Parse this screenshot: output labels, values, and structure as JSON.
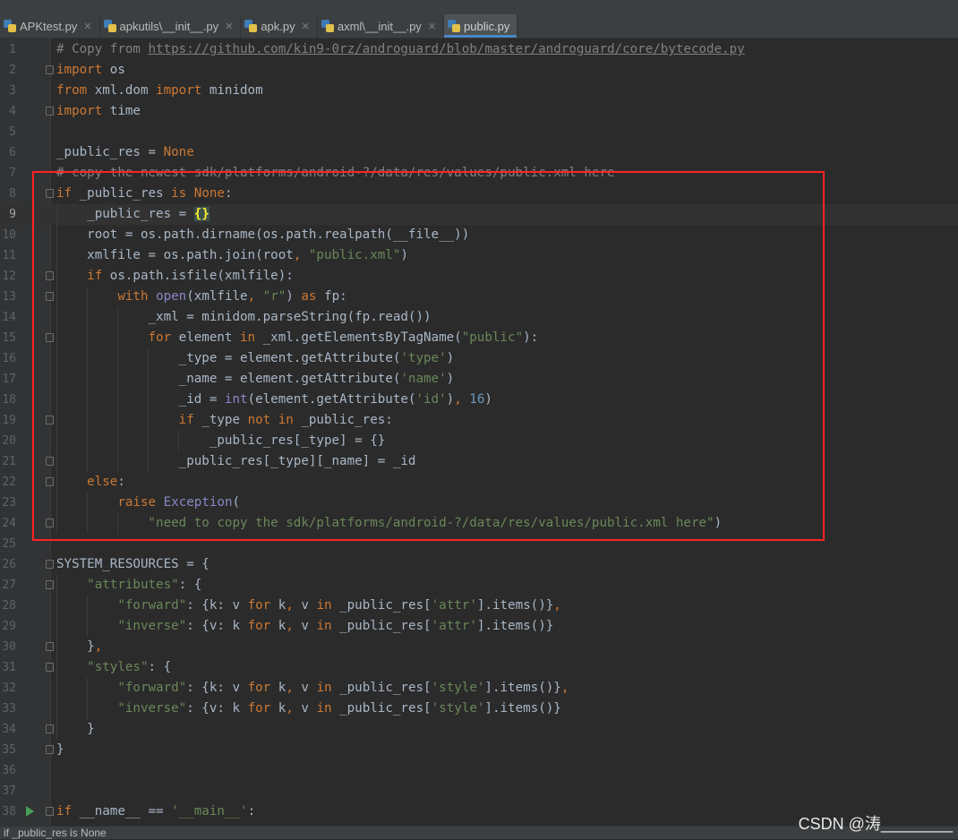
{
  "tabs": [
    {
      "label": "APKtest.py",
      "active": false
    },
    {
      "label": "apkutils\\__init__.py",
      "active": false
    },
    {
      "label": "apk.py",
      "active": false
    },
    {
      "label": "axml\\__init__.py",
      "active": false
    },
    {
      "label": "public.py",
      "active": true
    }
  ],
  "editor": {
    "current_line": 9,
    "lines": [
      {
        "n": "1",
        "parts": [
          [
            "c",
            "# Copy from "
          ],
          [
            "cu",
            "https://github.com/kin9-0rz/androguard/blob/master/androguard/core/bytecode.py"
          ]
        ]
      },
      {
        "n": "2",
        "fold": true,
        "parts": [
          [
            "k",
            "import"
          ],
          [
            "t",
            " os"
          ]
        ]
      },
      {
        "n": "3",
        "parts": [
          [
            "k",
            "from"
          ],
          [
            "t",
            " xml.dom "
          ],
          [
            "k",
            "import"
          ],
          [
            "t",
            " minidom"
          ]
        ]
      },
      {
        "n": "4",
        "fold": true,
        "parts": [
          [
            "k",
            "import"
          ],
          [
            "t",
            " time"
          ]
        ]
      },
      {
        "n": "5",
        "parts": []
      },
      {
        "n": "6",
        "parts": [
          [
            "t",
            "_public_res = "
          ],
          [
            "k",
            "None"
          ]
        ]
      },
      {
        "n": "7",
        "parts": [
          [
            "c",
            "# copy the newest sdk/platforms/android-?/data/res/values/public.xml here"
          ]
        ]
      },
      {
        "n": "8",
        "fold": true,
        "parts": [
          [
            "k",
            "if"
          ],
          [
            "t",
            " _public_res "
          ],
          [
            "k",
            "is"
          ],
          [
            "t",
            " "
          ],
          [
            "k",
            "None"
          ],
          [
            "t",
            ":"
          ]
        ]
      },
      {
        "n": "9",
        "parts": [
          [
            "t",
            "    _public_res = "
          ],
          [
            "br",
            "{}"
          ]
        ]
      },
      {
        "n": "10",
        "parts": [
          [
            "t",
            "    root = os.path.dirname(os.path.realpath(__file__))"
          ]
        ]
      },
      {
        "n": "11",
        "parts": [
          [
            "t",
            "    xmlfile = os.path.join(root"
          ],
          [
            "k",
            ", "
          ],
          [
            "s",
            "\"public.xml\""
          ],
          [
            "t",
            ")"
          ]
        ]
      },
      {
        "n": "12",
        "fold": true,
        "parts": [
          [
            "t",
            "    "
          ],
          [
            "k",
            "if"
          ],
          [
            "t",
            " os.path.isfile(xmlfile):"
          ]
        ]
      },
      {
        "n": "13",
        "fold": true,
        "parts": [
          [
            "t",
            "        "
          ],
          [
            "k",
            "with"
          ],
          [
            "t",
            " "
          ],
          [
            "b",
            "open"
          ],
          [
            "t",
            "(xmlfile"
          ],
          [
            "k",
            ", "
          ],
          [
            "s",
            "\"r\""
          ],
          [
            "t",
            ") "
          ],
          [
            "k",
            "as"
          ],
          [
            "t",
            " fp:"
          ]
        ]
      },
      {
        "n": "14",
        "parts": [
          [
            "t",
            "            _xml = minidom.parseString(fp.read())"
          ]
        ]
      },
      {
        "n": "15",
        "fold": true,
        "parts": [
          [
            "t",
            "            "
          ],
          [
            "k",
            "for"
          ],
          [
            "t",
            " element "
          ],
          [
            "k",
            "in"
          ],
          [
            "t",
            " _xml.getElementsByTagName("
          ],
          [
            "s",
            "\"public\""
          ],
          [
            "t",
            "):"
          ]
        ]
      },
      {
        "n": "16",
        "parts": [
          [
            "t",
            "                _type = element.getAttribute("
          ],
          [
            "s",
            "'type'"
          ],
          [
            "t",
            ")"
          ]
        ]
      },
      {
        "n": "17",
        "parts": [
          [
            "t",
            "                _name = element.getAttribute("
          ],
          [
            "s",
            "'name'"
          ],
          [
            "t",
            ")"
          ]
        ]
      },
      {
        "n": "18",
        "parts": [
          [
            "t",
            "                _id = "
          ],
          [
            "b",
            "int"
          ],
          [
            "t",
            "(element.getAttribute("
          ],
          [
            "s",
            "'id'"
          ],
          [
            "t",
            ")"
          ],
          [
            "k",
            ", "
          ],
          [
            "n",
            "16"
          ],
          [
            "t",
            ")"
          ]
        ]
      },
      {
        "n": "19",
        "fold": true,
        "parts": [
          [
            "t",
            "                "
          ],
          [
            "k",
            "if"
          ],
          [
            "t",
            " _type "
          ],
          [
            "k",
            "not in"
          ],
          [
            "t",
            " _public_res:"
          ]
        ]
      },
      {
        "n": "20",
        "parts": [
          [
            "t",
            "                    _public_res[_type] = {}"
          ]
        ]
      },
      {
        "n": "21",
        "fold": true,
        "parts": [
          [
            "t",
            "                _public_res[_type][_name] = _id"
          ]
        ]
      },
      {
        "n": "22",
        "fold": true,
        "parts": [
          [
            "t",
            "    "
          ],
          [
            "k",
            "else"
          ],
          [
            "t",
            ":"
          ]
        ]
      },
      {
        "n": "23",
        "parts": [
          [
            "t",
            "        "
          ],
          [
            "k",
            "raise"
          ],
          [
            "t",
            " "
          ],
          [
            "b",
            "Exception"
          ],
          [
            "t",
            "("
          ]
        ]
      },
      {
        "n": "24",
        "fold": true,
        "parts": [
          [
            "t",
            "            "
          ],
          [
            "s",
            "\"need to copy the sdk/platforms/android-?/data/res/values/public.xml here\""
          ],
          [
            "t",
            ")"
          ]
        ]
      },
      {
        "n": "25",
        "parts": []
      },
      {
        "n": "26",
        "fold": true,
        "parts": [
          [
            "t",
            "SYSTEM_RESOURCES = {"
          ]
        ]
      },
      {
        "n": "27",
        "fold": true,
        "parts": [
          [
            "t",
            "    "
          ],
          [
            "s",
            "\"attributes\""
          ],
          [
            "t",
            ": {"
          ]
        ]
      },
      {
        "n": "28",
        "parts": [
          [
            "t",
            "        "
          ],
          [
            "s",
            "\"forward\""
          ],
          [
            "t",
            ": {k: v "
          ],
          [
            "k",
            "for"
          ],
          [
            "t",
            " k"
          ],
          [
            "k",
            ", "
          ],
          [
            "t",
            "v "
          ],
          [
            "k",
            "in"
          ],
          [
            "t",
            " _public_res["
          ],
          [
            "s",
            "'attr'"
          ],
          [
            "t",
            "].items()}"
          ],
          [
            "k",
            ","
          ]
        ]
      },
      {
        "n": "29",
        "parts": [
          [
            "t",
            "        "
          ],
          [
            "s",
            "\"inverse\""
          ],
          [
            "t",
            ": {v: k "
          ],
          [
            "k",
            "for"
          ],
          [
            "t",
            " k"
          ],
          [
            "k",
            ", "
          ],
          [
            "t",
            "v "
          ],
          [
            "k",
            "in"
          ],
          [
            "t",
            " _public_res["
          ],
          [
            "s",
            "'attr'"
          ],
          [
            "t",
            "].items()}"
          ]
        ]
      },
      {
        "n": "30",
        "fold": true,
        "parts": [
          [
            "t",
            "    }"
          ],
          [
            "k",
            ","
          ]
        ]
      },
      {
        "n": "31",
        "fold": true,
        "parts": [
          [
            "t",
            "    "
          ],
          [
            "s",
            "\"styles\""
          ],
          [
            "t",
            ": {"
          ]
        ]
      },
      {
        "n": "32",
        "parts": [
          [
            "t",
            "        "
          ],
          [
            "s",
            "\"forward\""
          ],
          [
            "t",
            ": {k: v "
          ],
          [
            "k",
            "for"
          ],
          [
            "t",
            " k"
          ],
          [
            "k",
            ", "
          ],
          [
            "t",
            "v "
          ],
          [
            "k",
            "in"
          ],
          [
            "t",
            " _public_res["
          ],
          [
            "s",
            "'style'"
          ],
          [
            "t",
            "].items()}"
          ],
          [
            "k",
            ","
          ]
        ]
      },
      {
        "n": "33",
        "parts": [
          [
            "t",
            "        "
          ],
          [
            "s",
            "\"inverse\""
          ],
          [
            "t",
            ": {v: k "
          ],
          [
            "k",
            "for"
          ],
          [
            "t",
            " k"
          ],
          [
            "k",
            ", "
          ],
          [
            "t",
            "v "
          ],
          [
            "k",
            "in"
          ],
          [
            "t",
            " _public_res["
          ],
          [
            "s",
            "'style'"
          ],
          [
            "t",
            "].items()}"
          ]
        ]
      },
      {
        "n": "34",
        "fold": true,
        "parts": [
          [
            "t",
            "    }"
          ]
        ]
      },
      {
        "n": "35",
        "fold": true,
        "parts": [
          [
            "t",
            "}"
          ]
        ]
      },
      {
        "n": "36",
        "parts": []
      },
      {
        "n": "37",
        "parts": []
      },
      {
        "n": "38",
        "fold": true,
        "run": true,
        "parts": [
          [
            "k",
            "if"
          ],
          [
            "t",
            " __name__ == "
          ],
          [
            "s",
            "'__main__'"
          ],
          [
            "t",
            ":"
          ]
        ]
      }
    ]
  },
  "status": {
    "text": "if _public_res is None"
  },
  "watermark": "CSDN @涛________"
}
